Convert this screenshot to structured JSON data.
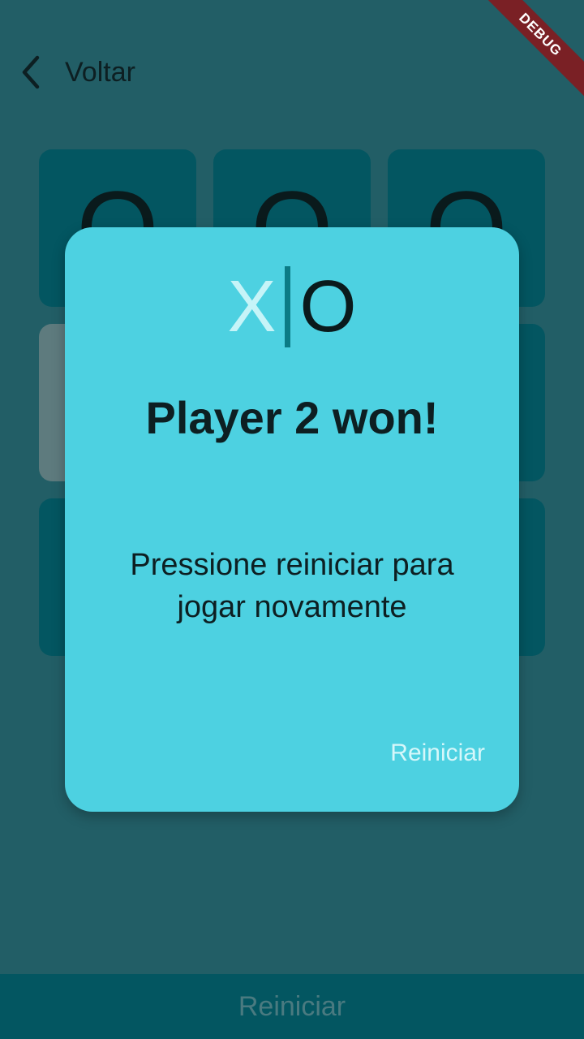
{
  "header": {
    "back_label": "Voltar"
  },
  "board": {
    "cells": [
      "O",
      "O",
      "O",
      "",
      "",
      "",
      "",
      "",
      ""
    ]
  },
  "bottom_bar": {
    "restart_label": "Reiniciar"
  },
  "debug_banner": "DEBUG",
  "dialog": {
    "logo_x": "X",
    "logo_o": "O",
    "title": "Player 2 won!",
    "message": "Pressione reiniciar para jogar novamente",
    "action_label": "Reiniciar"
  },
  "colors": {
    "background": "#225e66",
    "cell": "#035661",
    "dialog": "#4dd1e1",
    "accent": "#0b7b85",
    "debug": "#7a2025"
  }
}
